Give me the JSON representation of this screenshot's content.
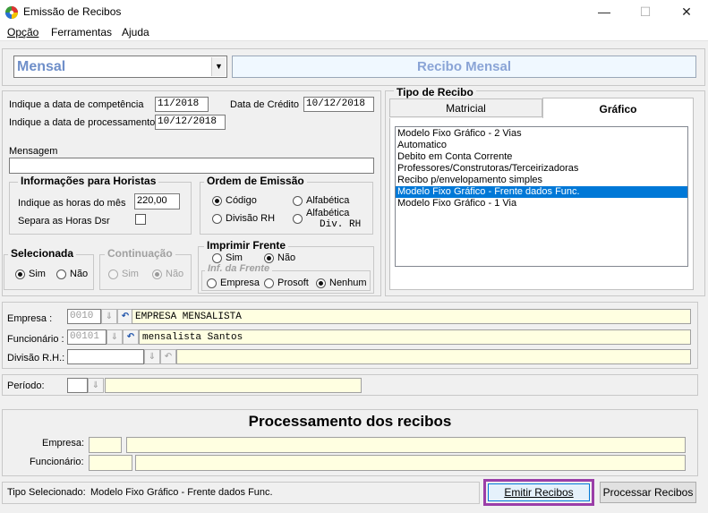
{
  "window": {
    "title": "Emissão de Recibos",
    "minimize": "—",
    "maximize": "☐",
    "close": "✕"
  },
  "menu": {
    "opcao": "Opção",
    "ferramentas": "Ferramentas",
    "ajuda": "Ajuda"
  },
  "header": {
    "type_select_value": "Mensal",
    "receipt_title": "Recibo Mensal"
  },
  "dates": {
    "competencia_label": "Indique a data de competência",
    "competencia_value": "11/2018",
    "credito_label": "Data de Crédito",
    "credito_value": "10/12/2018",
    "processamento_label": "Indique a data de processamento",
    "processamento_value": "10/12/2018"
  },
  "message": {
    "label": "Mensagem",
    "value": ""
  },
  "horistas": {
    "title": "Informações para Horistas",
    "hours_label": "Indique as horas do mês",
    "hours_value": "220,00",
    "separa_label": "Separa as Horas Dsr",
    "separa_checked": false
  },
  "ordem": {
    "title": "Ordem de Emissão",
    "codigo": "Código",
    "alfabetica": "Alfabética",
    "divisao": "Divisão RH",
    "alfabetica_div_1": "Alfabética",
    "alfabetica_div_2": "Div. RH",
    "selected": "Código"
  },
  "selecionada": {
    "title": "Selecionada",
    "sim": "Sim",
    "nao": "Não",
    "selected": "Sim"
  },
  "continuacao": {
    "title": "Continuação",
    "sim": "Sim",
    "nao": "Não",
    "selected": "Não"
  },
  "imprimir": {
    "title": "Imprimir Frente",
    "sim": "Sim",
    "nao": "Não",
    "selected": "Não",
    "inf_title": "Inf. da Frente",
    "empresa": "Empresa",
    "prosoft": "Prosoft",
    "nenhum": "Nenhum",
    "inf_selected": "Nenhum"
  },
  "tipo": {
    "title": "Tipo de Recibo",
    "tabs": [
      "Matricial",
      "Gráfico"
    ],
    "active_tab": "Gráfico",
    "options": [
      "Modelo Fixo Gráfico - 2 Vias",
      "Automatico",
      "Debito em Conta Corrente",
      "Professores/Construtoras/Terceirizadoras",
      "Recibo p/envelopamento simples",
      "Modelo Fixo Gráfico - Frente dados Func.",
      "Modelo Fixo Gráfico - 1 Via"
    ],
    "selected_index": 5
  },
  "filters": {
    "empresa_label": "Empresa :",
    "empresa_code": "0010",
    "empresa_name": "EMPRESA MENSALISTA",
    "funcionario_label": "Funcionário :",
    "funcionario_code": "00101",
    "funcionario_name": "mensalista Santos",
    "divisao_label": "Divisão R.H.:",
    "divisao_code": "",
    "divisao_name": "",
    "periodo_label": "Período:",
    "periodo_code": "",
    "periodo_name": ""
  },
  "processing": {
    "title": "Processamento dos recibos",
    "empresa_label": "Empresa:",
    "empresa_code": "",
    "empresa_name": "",
    "funcionario_label": "Funcionário:",
    "funcionario_code": "",
    "funcionario_name": ""
  },
  "status": {
    "label": "Tipo Selecionado:",
    "value": "Modelo Fixo Gráfico - Frente dados Func."
  },
  "buttons": {
    "emitir": "Emitir Recibos",
    "processar": "Processar Recibos"
  },
  "colors": {
    "highlight_border": "#9b3ea8",
    "selection": "#0078d7",
    "yellow_field": "#ffffe1",
    "title_blue": "#6f8fc9"
  }
}
